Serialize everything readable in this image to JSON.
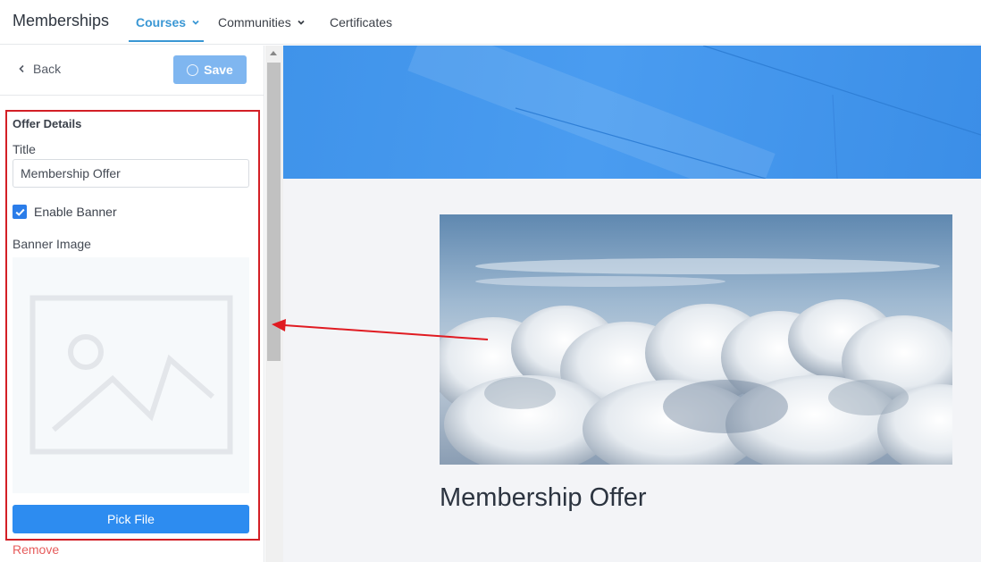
{
  "nav": {
    "brand": "Memberships",
    "items": [
      {
        "label": "Courses",
        "active": true,
        "dropdown": true
      },
      {
        "label": "Communities",
        "active": false,
        "dropdown": true
      },
      {
        "label": "Certificates",
        "active": false,
        "dropdown": false
      }
    ]
  },
  "sidebar": {
    "back_label": "Back",
    "save_label": "Save",
    "section_title": "Offer Details",
    "title_label": "Title",
    "title_value": "Membership Offer",
    "enable_banner_label": "Enable Banner",
    "enable_banner_checked": true,
    "banner_image_label": "Banner Image",
    "pick_file_label": "Pick File",
    "remove_label": "Remove"
  },
  "preview": {
    "offer_title": "Membership Offer"
  },
  "colors": {
    "accent": "#3a97d4",
    "primary_button": "#2d8cf0",
    "save_button_disabled": "#7fb6f0",
    "remove_link": "#e65c5c",
    "annotation_red": "#d31f26"
  },
  "icons": {
    "back": "chevron-left-icon",
    "save": "spinner-icon",
    "dropdown": "chevron-down-icon",
    "placeholder": "image-placeholder-icon"
  }
}
